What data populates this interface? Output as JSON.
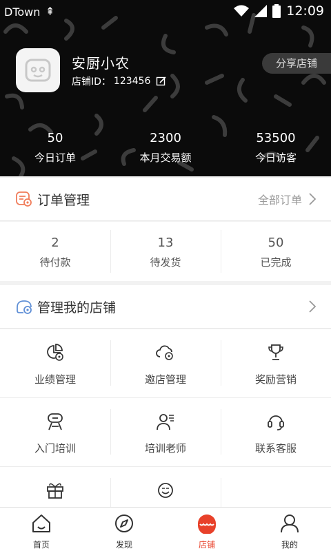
{
  "status_bar": {
    "carrier": "DTown",
    "time": "12:09"
  },
  "shop": {
    "name": "安厨小农",
    "id_label": "店铺ID：",
    "id_value": "123456",
    "share_label": "分享店铺"
  },
  "stats": [
    {
      "value": "50",
      "label": "今日订单"
    },
    {
      "value": "2300",
      "label": "本月交易额"
    },
    {
      "value": "53500",
      "label": "今日访客"
    }
  ],
  "orders": {
    "title": "订单管理",
    "all_label": "全部订单",
    "items": [
      {
        "count": "2",
        "label": "待付款"
      },
      {
        "count": "13",
        "label": "待发货"
      },
      {
        "count": "50",
        "label": "已完成"
      }
    ]
  },
  "manage": {
    "title": "管理我的店铺",
    "items": [
      {
        "label": "业绩管理",
        "icon": "performance-icon"
      },
      {
        "label": "邀店管理",
        "icon": "invite-shop-icon"
      },
      {
        "label": "奖励营销",
        "icon": "trophy-icon"
      },
      {
        "label": "入门培训",
        "icon": "training-icon"
      },
      {
        "label": "培训老师",
        "icon": "teacher-icon"
      },
      {
        "label": "联系客服",
        "icon": "headset-icon"
      },
      {
        "label": "",
        "icon": "gift-icon"
      },
      {
        "label": "",
        "icon": "smile-badge-icon"
      }
    ]
  },
  "tabs": [
    {
      "label": "首页",
      "icon": "home-icon",
      "active": false
    },
    {
      "label": "发现",
      "icon": "compass-icon",
      "active": false
    },
    {
      "label": "店铺",
      "icon": "shop-icon",
      "active": true
    },
    {
      "label": "我的",
      "icon": "user-icon",
      "active": false
    }
  ],
  "colors": {
    "accent": "#e8412a",
    "header_bg": "#0b0b0b",
    "order_icon": "#f07c5a",
    "manage_icon": "#5f8fd6"
  }
}
